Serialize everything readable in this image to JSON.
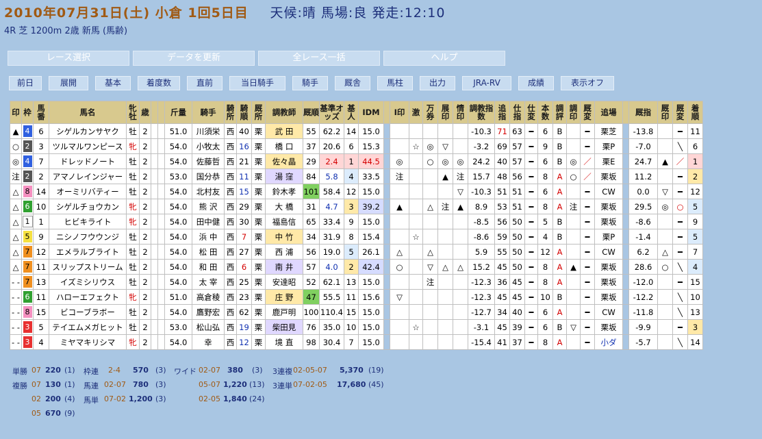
{
  "header": {
    "title": "2010年07月31日(土) 小倉 1回5日目",
    "weather": "天候:晴 馬場:良 発走:12:10",
    "subtitle": "4R 芝 1200m 2歳 新馬 (馬齢)"
  },
  "nav": [
    "レース選択",
    "データを更新",
    "全レース一括",
    "ヘルプ"
  ],
  "buttons": [
    "前日",
    "展開",
    "基本",
    "着度数",
    "直前",
    "当日騎手",
    "騎手",
    "厩舎",
    "馬柱",
    "出力",
    "JRA-RV",
    "成績",
    "表示オフ"
  ],
  "table": {
    "headers": [
      "印",
      "枠",
      "馬番",
      "馬名",
      "牝牡",
      "歳",
      "",
      "",
      "斤量",
      "騎手",
      "騎所",
      "騎順",
      "厩所",
      "調教師",
      "厩順",
      "基準オッズ",
      "基人",
      "IDM",
      "",
      "I印",
      "激",
      "万券",
      "展印",
      "情印",
      "調教指数",
      "追指",
      "仕指",
      "仕変",
      "本数",
      "調評",
      "調印",
      "厩変",
      "追場",
      "",
      "厩指",
      "厩印",
      "厩変",
      "着順"
    ],
    "rows": [
      [
        "▲",
        "4",
        "6",
        "シゲルカンサヤク",
        "牡",
        "2",
        "",
        "",
        "51.0",
        "川須栄",
        "西",
        "40",
        "栗",
        "武 田",
        "55",
        "62.2",
        "14",
        "15.0",
        "",
        "",
        "",
        "",
        "",
        "",
        "-10.3",
        "71",
        "63",
        "━",
        "6",
        "B",
        "",
        "━",
        "栗芝",
        "",
        "-13.8",
        "",
        "━",
        "11"
      ],
      [
        "○",
        "2",
        "3",
        "ツルマルワンピース",
        "牝",
        "2",
        "",
        "",
        "54.0",
        "小牧太",
        "西",
        "16",
        "栗",
        "橋 口",
        "37",
        "20.6",
        "6",
        "15.3",
        "",
        "",
        "☆",
        "◎",
        "▽",
        "",
        "-3.2",
        "69",
        "57",
        "━",
        "9",
        "B",
        "",
        "━",
        "栗P",
        "",
        "-7.0",
        "",
        "╲",
        "6"
      ],
      [
        "◎",
        "4",
        "7",
        "ドレッドノート",
        "牡",
        "2",
        "",
        "",
        "54.0",
        "佐藤哲",
        "西",
        "21",
        "栗",
        "佐々晶",
        "29",
        "2.4",
        "1",
        "44.5",
        "",
        "◎",
        "",
        "○",
        "◎",
        "◎",
        "24.2",
        "40",
        "57",
        "━",
        "6",
        "B",
        "◎",
        "／",
        "栗E",
        "",
        "24.7",
        "▲",
        "／",
        "1"
      ],
      [
        "注",
        "2",
        "2",
        "アマノレインジャー",
        "牡",
        "2",
        "",
        "",
        "53.0",
        "国分恭",
        "西",
        "11",
        "栗",
        "湯 窪",
        "84",
        "5.8",
        "4",
        "33.5",
        "",
        "注",
        "",
        "",
        "▲",
        "注",
        "15.7",
        "48",
        "56",
        "━",
        "8",
        "A",
        "○",
        "／",
        "栗坂",
        "",
        "11.2",
        "",
        "━",
        "2"
      ],
      [
        "△",
        "8",
        "14",
        "オーミリバティー",
        "牡",
        "2",
        "",
        "",
        "54.0",
        "北村友",
        "西",
        "15",
        "栗",
        "鈴木孝",
        "101",
        "58.4",
        "12",
        "15.0",
        "",
        "",
        "",
        "",
        "",
        "▽",
        "-10.3",
        "51",
        "51",
        "━",
        "6",
        "A",
        "",
        "━",
        "CW",
        "",
        "0.0",
        "▽",
        "━",
        "12"
      ],
      [
        "△",
        "6",
        "10",
        "シゲルチョウカン",
        "牝",
        "2",
        "",
        "",
        "54.0",
        "熊 沢",
        "西",
        "29",
        "栗",
        "大 橋",
        "31",
        "4.7",
        "3",
        "39.2",
        "",
        "▲",
        "",
        "△",
        "注",
        "▲",
        "8.9",
        "53",
        "51",
        "━",
        "8",
        "A",
        "注",
        "━",
        "栗坂",
        "",
        "29.5",
        "◎",
        "○",
        "5"
      ],
      [
        "△",
        "1",
        "1",
        "ヒビキライト",
        "牝",
        "2",
        "",
        "",
        "54.0",
        "田中健",
        "西",
        "30",
        "栗",
        "福島信",
        "65",
        "33.4",
        "9",
        "15.0",
        "",
        "",
        "",
        "",
        "",
        "",
        "-8.5",
        "56",
        "50",
        "━",
        "5",
        "B",
        "",
        "━",
        "栗坂",
        "",
        "-8.6",
        "",
        "━",
        "9"
      ],
      [
        "△",
        "5",
        "9",
        "ニシノフウウンジ",
        "牡",
        "2",
        "",
        "",
        "54.0",
        "浜 中",
        "西",
        "7",
        "栗",
        "中 竹",
        "34",
        "31.9",
        "8",
        "15.4",
        "",
        "",
        "☆",
        "",
        "",
        "",
        "-8.6",
        "59",
        "50",
        "━",
        "4",
        "B",
        "",
        "━",
        "栗P",
        "",
        "-1.4",
        "",
        "━",
        "5"
      ],
      [
        "△",
        "7",
        "12",
        "エメラルブライト",
        "牡",
        "2",
        "",
        "",
        "54.0",
        "松 田",
        "西",
        "27",
        "栗",
        "西 浦",
        "56",
        "19.0",
        "5",
        "26.1",
        "",
        "△",
        "",
        "△",
        "",
        "",
        "5.9",
        "55",
        "50",
        "━",
        "12",
        "A",
        "",
        "━",
        "CW",
        "",
        "6.2",
        "△",
        "━",
        "7"
      ],
      [
        "△",
        "7",
        "11",
        "スリップストリーム",
        "牡",
        "2",
        "",
        "",
        "54.0",
        "和 田",
        "西",
        "6",
        "栗",
        "南 井",
        "57",
        "4.0",
        "2",
        "42.4",
        "",
        "○",
        "",
        "▽",
        "△",
        "△",
        "15.2",
        "45",
        "50",
        "━",
        "8",
        "A",
        "▲",
        "━",
        "栗坂",
        "",
        "28.6",
        "○",
        "╲",
        "4"
      ],
      [
        "- -",
        "7",
        "13",
        "イズミシリウス",
        "牡",
        "2",
        "",
        "",
        "54.0",
        "太 宰",
        "西",
        "25",
        "栗",
        "安達昭",
        "52",
        "62.1",
        "13",
        "15.0",
        "",
        "",
        "",
        "注",
        "",
        "",
        "-12.3",
        "36",
        "45",
        "━",
        "8",
        "A",
        "",
        "━",
        "栗坂",
        "",
        "-12.0",
        "",
        "━",
        "15"
      ],
      [
        "- -",
        "6",
        "11",
        "ハローエフェクト",
        "牝",
        "2",
        "",
        "",
        "51.0",
        "高倉稜",
        "西",
        "23",
        "栗",
        "庄 野",
        "47",
        "55.5",
        "11",
        "15.6",
        "",
        "▽",
        "",
        "",
        "",
        "",
        "-12.3",
        "45",
        "45",
        "━",
        "10",
        "B",
        "",
        "━",
        "栗坂",
        "",
        "-12.2",
        "",
        "╲",
        "10"
      ],
      [
        "- -",
        "8",
        "15",
        "ビコーブラボー",
        "牡",
        "2",
        "",
        "",
        "54.0",
        "鷹野宏",
        "西",
        "62",
        "栗",
        "鹿戸明",
        "100",
        "110.4",
        "15",
        "15.0",
        "",
        "",
        "",
        "",
        "",
        "",
        "-12.7",
        "34",
        "40",
        "━",
        "6",
        "A",
        "",
        "━",
        "CW",
        "",
        "-11.8",
        "",
        "╲",
        "13"
      ],
      [
        "- -",
        "3",
        "5",
        "テイエムメガヒット",
        "牡",
        "2",
        "",
        "",
        "53.0",
        "松山弘",
        "西",
        "19",
        "栗",
        "柴田見",
        "76",
        "35.0",
        "10",
        "15.0",
        "",
        "",
        "☆",
        "",
        "",
        "",
        "-3.1",
        "45",
        "39",
        "━",
        "6",
        "B",
        "▽",
        "━",
        "栗坂",
        "",
        "-9.9",
        "",
        "━",
        "3"
      ],
      [
        "- -",
        "3",
        "4",
        "ミヤマキリシマ",
        "牝",
        "2",
        "",
        "",
        "54.0",
        "幸",
        "西",
        "12",
        "栗",
        "境 直",
        "98",
        "30.4",
        "7",
        "15.0",
        "",
        "",
        "",
        "",
        "",
        "",
        "-15.4",
        "41",
        "37",
        "━",
        "8",
        "A",
        "",
        "━",
        "小ダ",
        "",
        "-5.7",
        "",
        "╲",
        "14"
      ]
    ]
  },
  "payouts": {
    "tansho": {
      "label": "単勝",
      "combo": "07",
      "amount": "220",
      "pop": "(1)"
    },
    "fukusho": [
      {
        "label": "複勝",
        "combo": "07",
        "amount": "130",
        "pop": "(1)"
      },
      {
        "label": "",
        "combo": "02",
        "amount": "200",
        "pop": "(4)"
      },
      {
        "label": "",
        "combo": "05",
        "amount": "670",
        "pop": "(9)"
      }
    ],
    "wakuren": {
      "label": "枠連",
      "combo": "2-4",
      "amount": "570",
      "pop": "(3)"
    },
    "umaren": {
      "label": "馬連",
      "combo": "02-07",
      "amount": "780",
      "pop": "(3)"
    },
    "umatan": {
      "label": "馬単",
      "combo": "07-02",
      "amount": "1,200",
      "pop": "(3)"
    },
    "wide": [
      {
        "label": "ワイド",
        "combo": "02-07",
        "amount": "380",
        "pop": "(3)"
      },
      {
        "label": "",
        "combo": "05-07",
        "amount": "1,220",
        "pop": "(13)"
      },
      {
        "label": "",
        "combo": "02-05",
        "amount": "1,840",
        "pop": "(24)"
      }
    ],
    "sanrenpuku": {
      "label": "3連複",
      "combo": "02-05-07",
      "amount": "5,370",
      "pop": "(19)"
    },
    "sanrentan": {
      "label": "3連単",
      "combo": "07-02-05",
      "amount": "17,680",
      "pop": "(45)"
    }
  }
}
